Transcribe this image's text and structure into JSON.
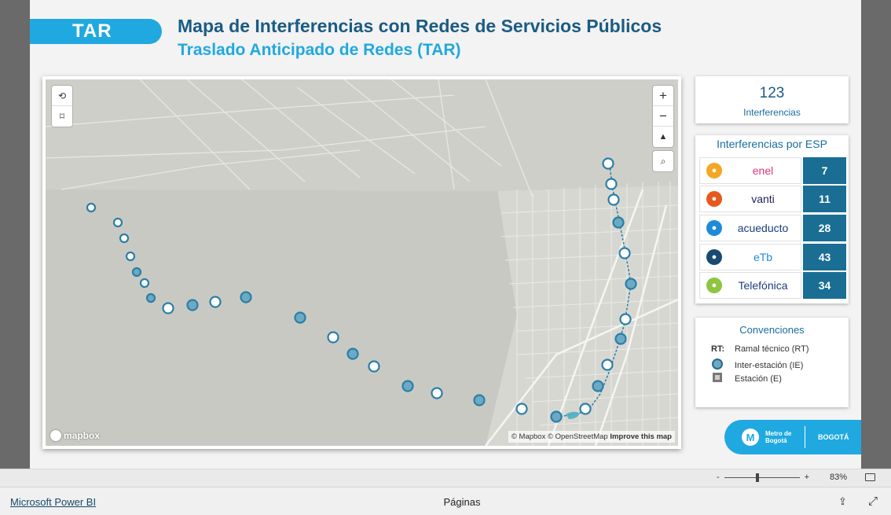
{
  "header": {
    "tag": "TAR",
    "title": "Mapa de Interferencias con Redes de Servicios Públicos",
    "subtitle": "Traslado Anticipado de Redes (TAR)"
  },
  "map": {
    "attribution": "© Mapbox © OpenStreetMap",
    "improve_link": "Improve this map",
    "logo_text": "mapbox",
    "controls": [
      "zoom-in",
      "zoom-out",
      "reset-bearing",
      "search"
    ],
    "left_tools": [
      "lasso-select",
      "rect-select"
    ]
  },
  "kpi": {
    "value": "123",
    "label": "Interferencias"
  },
  "esp": {
    "title": "Interferencias por ESP",
    "items": [
      {
        "name": "enel",
        "value": "7",
        "icon_color": "#f5a623",
        "text_color": "#e0357a",
        "icon": "bolt-icon"
      },
      {
        "name": "vanti",
        "value": "11",
        "icon_color": "#e8591c",
        "text_color": "#1f1f5c",
        "icon": "gas-icon"
      },
      {
        "name": "acueducto",
        "value": "28",
        "icon_color": "#1f8ad8",
        "text_color": "#1c3c7a",
        "icon": "water-icon"
      },
      {
        "name": "eTb",
        "value": "43",
        "icon_color": "#1a4a70",
        "text_color": "#1f8ad8",
        "icon": "telecom-icon"
      },
      {
        "name": "Telefónica",
        "value": "34",
        "icon_color": "#8cc63f",
        "text_color": "#1c3c7a",
        "icon": "phone-icon"
      }
    ]
  },
  "conventions": {
    "title": "Convenciones",
    "rows": [
      {
        "key": "RT:",
        "label": "Ramal técnico (RT)"
      },
      {
        "key": "",
        "label": "Inter-estación (IE)"
      },
      {
        "key": "",
        "label": "Estación (E)"
      }
    ]
  },
  "brand": {
    "metro": "Metro de Bogotá",
    "city": "BOGOTÁ"
  },
  "zoom": {
    "minus": "-",
    "plus": "+",
    "percent": "83%",
    "level": 0.83
  },
  "footer": {
    "app_link": "Microsoft Power BI",
    "pages": "Páginas"
  },
  "colors": {
    "accent": "#1fa9e0",
    "dark_blue": "#1a5b84",
    "value_box": "#1a6e94",
    "marker_fill": "#6ba9c4"
  }
}
